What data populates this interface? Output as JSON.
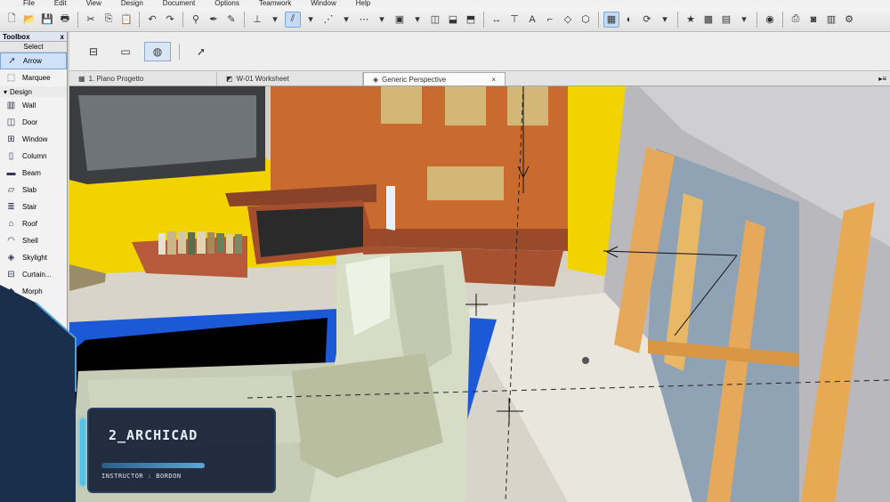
{
  "menu": [
    "File",
    "Edit",
    "View",
    "Design",
    "Document",
    "Options",
    "Teamwork",
    "Window",
    "Help"
  ],
  "toolbox": {
    "title": "Toolbox",
    "close": "x",
    "select_header": "Select",
    "design_header": "Design",
    "select_tools": [
      {
        "label": "Arrow",
        "icon": "arrow-pointer-icon"
      },
      {
        "label": "Marquee",
        "icon": "marquee-icon"
      }
    ],
    "design_tools": [
      {
        "label": "Wall",
        "icon": "wall-icon"
      },
      {
        "label": "Door",
        "icon": "door-icon"
      },
      {
        "label": "Window",
        "icon": "window-icon"
      },
      {
        "label": "Column",
        "icon": "column-icon"
      },
      {
        "label": "Beam",
        "icon": "beam-icon"
      },
      {
        "label": "Slab",
        "icon": "slab-icon"
      },
      {
        "label": "Stair",
        "icon": "stair-icon"
      },
      {
        "label": "Roof",
        "icon": "roof-icon"
      },
      {
        "label": "Shell",
        "icon": "shell-icon"
      },
      {
        "label": "Skylight",
        "icon": "skylight-icon"
      },
      {
        "label": "Curtain...",
        "icon": "curtain-wall-icon"
      },
      {
        "label": "Morph",
        "icon": "morph-icon"
      }
    ]
  },
  "tabs": [
    {
      "label": "1. Piano Progetto",
      "icon": "floorplan-icon",
      "active": false
    },
    {
      "label": "W-01 Worksheet",
      "icon": "worksheet-icon",
      "active": false
    },
    {
      "label": "Generic Perspective",
      "icon": "3d-window-icon",
      "active": true
    }
  ],
  "tabs_overflow": "▸≡",
  "overlay": {
    "title": "2_ARCHICAD",
    "subtitle": "INSTRUCTOR : BORDON"
  },
  "colors": {
    "accent": "#53c3e8",
    "wall_yellow": "#f2d300",
    "wall_orange": "#c86a2e",
    "floor": "#d8d3c8",
    "rug_blue": "#1b59d6",
    "sofa": "#d6dcc6"
  }
}
